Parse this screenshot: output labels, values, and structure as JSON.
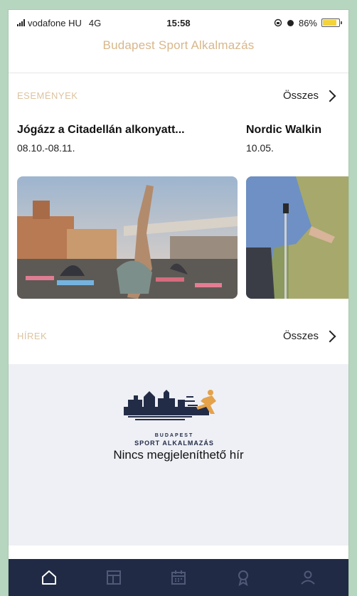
{
  "status_bar": {
    "carrier": "vodafone HU",
    "network": "4G",
    "time": "15:58",
    "battery": "86%",
    "battery_level": 0.86
  },
  "app_title": "Budapest Sport Alkalmazás",
  "events": {
    "label": "ESEMÉNYEK",
    "see_all": "Összes",
    "items": [
      {
        "title": "Jógázz a Citadellán alkonyatt...",
        "date": "08.10.-08.11.",
        "image": "rooftop-yoga-photo"
      },
      {
        "title": "Nordic Walkin",
        "date": "10.05.",
        "image": "nordic-walking-photo"
      }
    ]
  },
  "news": {
    "label": "HÍREK",
    "see_all": "Összes",
    "logo_line1": "BUDAPEST",
    "logo_line2": "SPORT ALKALMAZÁS",
    "empty_message": "Nincs megjeleníthető hír"
  },
  "tabbar": {
    "items": [
      {
        "icon": "home-icon",
        "active": true
      },
      {
        "icon": "dashboard-icon",
        "active": false
      },
      {
        "icon": "calendar-icon",
        "active": false
      },
      {
        "icon": "sport-icon",
        "active": false
      },
      {
        "icon": "profile-icon",
        "active": false
      }
    ]
  },
  "colors": {
    "accent": "#d8b78a",
    "tabbar_bg": "#212a45",
    "news_bg": "#eef0f5",
    "outer_bg": "#b6d6bf"
  }
}
